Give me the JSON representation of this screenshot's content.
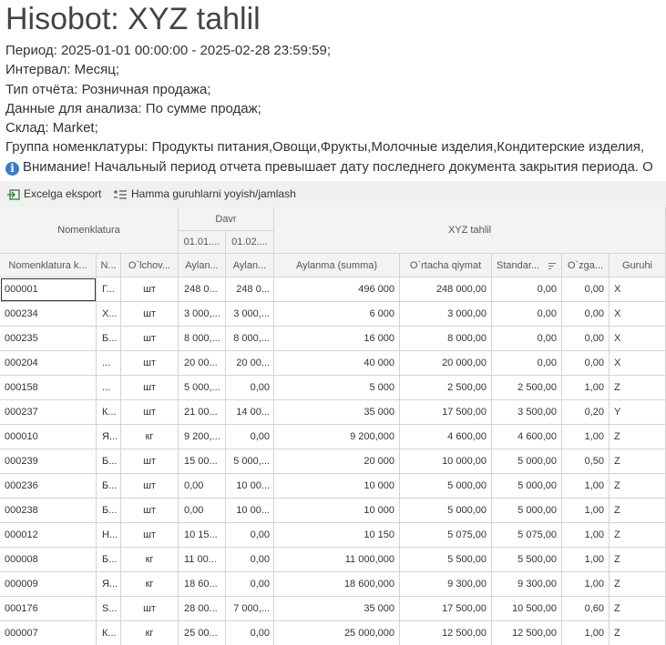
{
  "title": "Hisobot: XYZ tahlil",
  "params": [
    "Период: 2025-01-01 00:00:00 - 2025-02-28 23:59:59;",
    "Интервал: Месяц;",
    "Тип отчёта: Розничная продажа;",
    "Данные для анализа: По сумме продаж;",
    "Склад: Market;",
    "Группа номенклатуры: Продукты питания,Овощи,Фрукты,Молочные изделия,Кондитерские изделия,"
  ],
  "warning": "Внимание! Начальный период отчета превышает дату последнего документа закрытия периода. О",
  "toolbar": {
    "export_label": "Excelga eksport",
    "group_label": "Hamma guruhlarni yoyish/jamlash"
  },
  "header": {
    "group_nomenklatura": "Nomenklatura",
    "group_davr": "Davr",
    "group_xyz": "XYZ tahlil",
    "davr_cols": [
      "01.01....",
      "01.02...."
    ],
    "columns": [
      "Nomenklatura k...",
      "N...",
      "O`lchov...",
      "Aylan...",
      "Aylan...",
      "Aylanma (summa)",
      "O`rtacha qiymat",
      "Standar...",
      "O`zga...",
      "Guruhi"
    ]
  },
  "rows": [
    [
      "000001",
      "Г...",
      "шт",
      "248 0...",
      "248 0...",
      "496 000",
      "248 000,00",
      "0,00",
      "0,00",
      "X"
    ],
    [
      "000234",
      "Х...",
      "шт",
      "3 000,...",
      "3 000,...",
      "6 000",
      "3 000,00",
      "0,00",
      "0,00",
      "X"
    ],
    [
      "000235",
      "Б...",
      "шт",
      "8 000,...",
      "8 000,...",
      "16 000",
      "8 000,00",
      "0,00",
      "0,00",
      "X"
    ],
    [
      "000204",
      "...",
      "шт",
      "20 00...",
      "20 00...",
      "40 000",
      "20 000,00",
      "0,00",
      "0,00",
      "X"
    ],
    [
      "000158",
      "...",
      "шт",
      "5 000,...",
      "0,00",
      "5 000",
      "2 500,00",
      "2 500,00",
      "1,00",
      "Z"
    ],
    [
      "000237",
      "К...",
      "шт",
      "21 00...",
      "14 00...",
      "35 000",
      "17 500,00",
      "3 500,00",
      "0,20",
      "Y"
    ],
    [
      "000010",
      "Я...",
      "кг",
      "9 200,...",
      "0,00",
      "9 200,000",
      "4 600,00",
      "4 600,00",
      "1,00",
      "Z"
    ],
    [
      "000239",
      "Б...",
      "шт",
      "15 00...",
      "5 000,...",
      "20 000",
      "10 000,00",
      "5 000,00",
      "0,50",
      "Z"
    ],
    [
      "000236",
      "Б...",
      "шт",
      "0,00",
      "10 00...",
      "10 000",
      "5 000,00",
      "5 000,00",
      "1,00",
      "Z"
    ],
    [
      "000238",
      "Б...",
      "шт",
      "0,00",
      "10 00...",
      "10 000",
      "5 000,00",
      "5 000,00",
      "1,00",
      "Z"
    ],
    [
      "000012",
      "Н...",
      "шт",
      "10 15...",
      "0,00",
      "10 150",
      "5 075,00",
      "5 075,00",
      "1,00",
      "Z"
    ],
    [
      "000008",
      "Б...",
      "кг",
      "11 00...",
      "0,00",
      "11 000,000",
      "5 500,00",
      "5 500,00",
      "1,00",
      "Z"
    ],
    [
      "000009",
      "Я...",
      "кг",
      "18 60...",
      "0,00",
      "18 600,000",
      "9 300,00",
      "9 300,00",
      "1,00",
      "Z"
    ],
    [
      "000176",
      "S...",
      "шт",
      "28 00...",
      "7 000,...",
      "35 000",
      "17 500,00",
      "10 500,00",
      "0,60",
      "Z"
    ],
    [
      "000007",
      "К...",
      "кг",
      "25 00...",
      "0,00",
      "25 000,000",
      "12 500,00",
      "12 500,00",
      "1,00",
      "Z"
    ]
  ]
}
